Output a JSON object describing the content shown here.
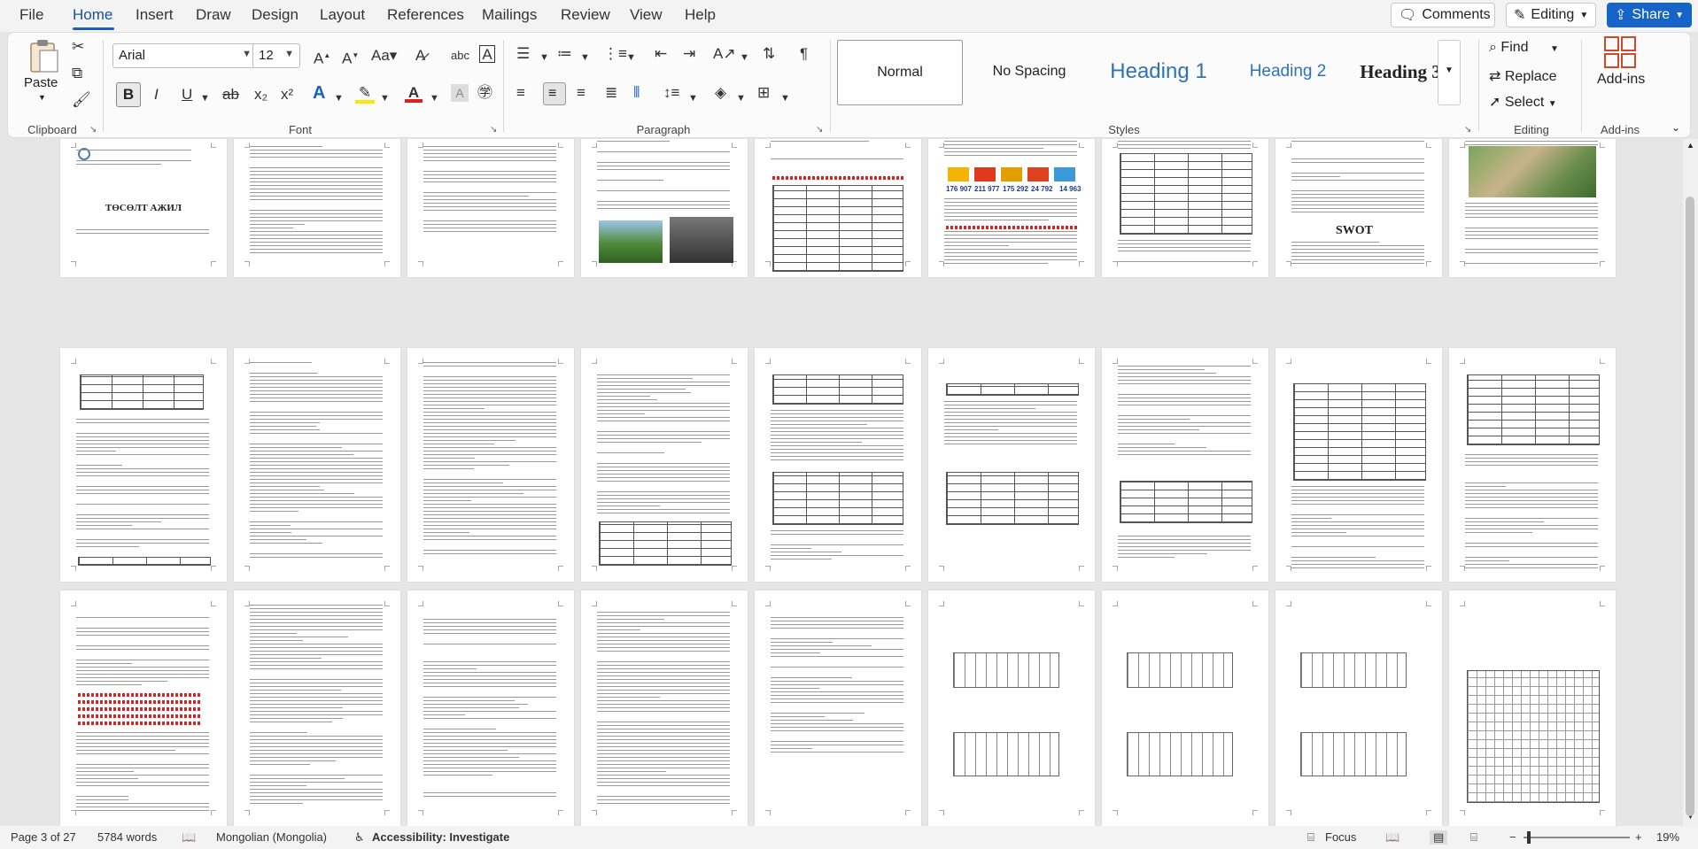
{
  "menu": {
    "file": "File",
    "home": "Home",
    "insert": "Insert",
    "draw": "Draw",
    "design": "Design",
    "layout": "Layout",
    "references": "References",
    "mailings": "Mailings",
    "review": "Review",
    "view": "View",
    "help": "Help"
  },
  "top_buttons": {
    "comments": "Comments",
    "editing": "Editing",
    "share": "Share"
  },
  "ribbon": {
    "clipboard": {
      "paste": "Paste",
      "label": "Clipboard"
    },
    "font": {
      "name": "Arial",
      "size": "12",
      "label": "Font"
    },
    "paragraph": {
      "label": "Paragraph"
    },
    "styles": {
      "label": "Styles",
      "items": [
        "Normal",
        "No Spacing",
        "Heading 1",
        "Heading 2",
        "Heading 3"
      ]
    },
    "editing": {
      "find": "Find",
      "replace": "Replace",
      "select": "Select",
      "label": "Editing"
    },
    "addins": {
      "addins": "Add-ins",
      "label": "Add-ins"
    }
  },
  "document": {
    "page1_title": "ТӨСӨЛТ АЖИЛ",
    "swot": "SWOT",
    "numbers": [
      "176 907",
      "211 977",
      "175 292",
      "24 792",
      "14 963"
    ]
  },
  "status": {
    "page": "Page 3 of 27",
    "words": "5784 words",
    "language": "Mongolian (Mongolia)",
    "accessibility": "Accessibility: Investigate",
    "focus": "Focus",
    "zoom": "19%"
  },
  "colors": {
    "accent": "#1664c8",
    "heading": "#2e74b5",
    "proofing_error": "#dd2222"
  }
}
